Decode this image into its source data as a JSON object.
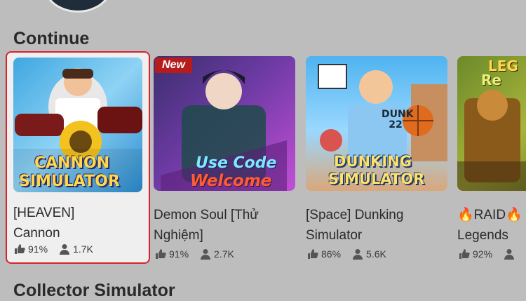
{
  "continue_section": {
    "title": "Continue",
    "games": [
      {
        "title_line1": "[HEAVEN]",
        "title_line2": "Cannon",
        "rating": "91%",
        "players": "1.7K",
        "thumb_text_1": "CANNON",
        "thumb_text_2": "SIMULATOR",
        "selected": true
      },
      {
        "title_line1": "Demon Soul [Thử",
        "title_line2": "Nghiệm]",
        "rating": "91%",
        "players": "2.7K",
        "badge": "New",
        "thumb_text_1": "Use Code",
        "thumb_text_2": "Welcome"
      },
      {
        "title_line1": "[Space] Dunking",
        "title_line2": "Simulator",
        "rating": "86%",
        "players": "5.6K",
        "thumb_text_1": "DUNKING",
        "thumb_text_2": "SIMULATOR",
        "jersey": "DUNK 22"
      },
      {
        "title_line1": "🔥RAID🔥",
        "title_line2": "Legends",
        "rating": "92%",
        "players": "",
        "thumb_text_1": "LEG",
        "thumb_text_2": "Re"
      }
    ]
  },
  "next_section": {
    "title": "Collector Simulator"
  },
  "colors": {
    "selected_border": "#d3242f",
    "background": "#bdbdbd"
  }
}
